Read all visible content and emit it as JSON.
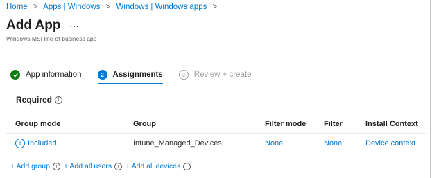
{
  "breadcrumb": [
    "Home",
    "Apps | Windows",
    "Windows | Windows apps"
  ],
  "breadcrumb_separator": ">",
  "page": {
    "title": "Add App",
    "more": "...",
    "subtitle": "Windows MSI line-of-business app"
  },
  "tabs": [
    {
      "label": "App information",
      "state": "done",
      "icon": "checkmark-icon"
    },
    {
      "label": "Assignments",
      "state": "active",
      "number": "2"
    },
    {
      "label": "Review + create",
      "state": "todo",
      "number": "3"
    }
  ],
  "section": {
    "title": "Required",
    "info": "i"
  },
  "table": {
    "headers": [
      "Group mode",
      "Group",
      "Filter mode",
      "Filter",
      "Install Context"
    ],
    "rows": [
      {
        "group_mode": "Included",
        "group": "Intune_Managed_Devices",
        "filter_mode": "None",
        "filter": "None",
        "install_context": "Device context"
      }
    ]
  },
  "actions": [
    "+ Add group",
    "+ Add all users",
    "+ Add all devices"
  ],
  "colors": {
    "accent": "#0078d4",
    "success": "#107c10",
    "text": "#323130",
    "muted": "#a19f9d"
  }
}
